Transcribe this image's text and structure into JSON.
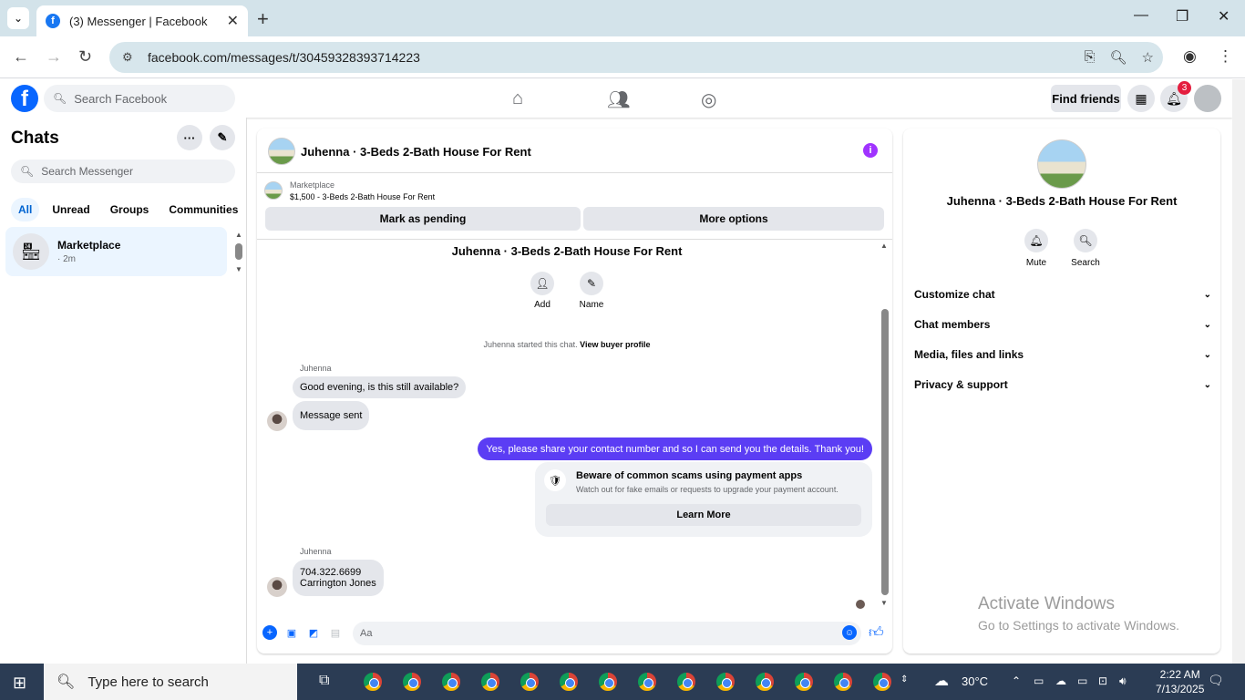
{
  "browser": {
    "tab_title": "(3) Messenger | Facebook",
    "url": "facebook.com/messages/t/30459328393714223"
  },
  "fb": {
    "search_placeholder": "Search Facebook",
    "find_friends": "Find friends",
    "notifications_count": "3"
  },
  "sidebar": {
    "title": "Chats",
    "search_placeholder": "Search Messenger",
    "filters": [
      "All",
      "Unread",
      "Groups",
      "Communities"
    ],
    "conversation": {
      "name": "Marketplace",
      "time": "· 2m"
    }
  },
  "chat": {
    "title": "Juhenna · 3-Beds 2-Bath House For Rent",
    "marketplace_label": "Marketplace",
    "listing": "$1,500 - 3-Beds 2-Bath House For Rent",
    "mark_pending": "Mark as pending",
    "more_options": "More options",
    "thread_title": "Juhenna · 3-Beds 2-Bath House For Rent",
    "add_label": "Add",
    "name_label": "Name",
    "started_text": "Juhenna started this chat.",
    "view_buyer": "View buyer profile",
    "sender": "Juhenna",
    "msg1": "Good evening, is this still available?",
    "msg2": "Message sent",
    "msg_out": "Yes, please share your contact number and so I can send you the details. Thank you!",
    "scam_title": "Beware of common scams using payment apps",
    "scam_sub": "Watch out for fake emails or requests to upgrade your payment account.",
    "learn_more": "Learn More",
    "msg3_line1": "704.322.6699",
    "msg3_line2": "Carrington Jones",
    "composer_placeholder": "Aa"
  },
  "info": {
    "name": "Juhenna · 3-Beds 2-Bath House For Rent",
    "mute": "Mute",
    "search": "Search",
    "sections": [
      "Customize chat",
      "Chat members",
      "Media, files and links",
      "Privacy & support"
    ]
  },
  "watermark": {
    "line1": "Activate Windows",
    "line2": "Go to Settings to activate Windows."
  },
  "taskbar": {
    "search_placeholder": "Type here to search",
    "temperature": "30°C",
    "time": "2:22 AM",
    "date": "7/13/2025",
    "notif_count": "1"
  }
}
